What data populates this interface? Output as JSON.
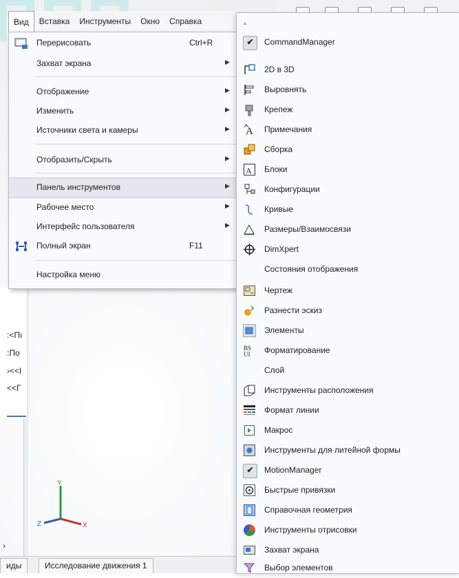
{
  "menubar": {
    "items": [
      "Вид",
      "Вставка",
      "Инструменты",
      "Окно",
      "Справка"
    ]
  },
  "view_menu": {
    "items": [
      {
        "label": "Перерисовать",
        "shortcut": "Ctrl+R",
        "icon": "redraw-icon",
        "submenu": false
      },
      {
        "label": "Захват экрана",
        "shortcut": "",
        "icon": "",
        "submenu": true
      },
      {
        "label": "Отображение",
        "shortcut": "",
        "icon": "",
        "submenu": true
      },
      {
        "label": "Изменить",
        "shortcut": "",
        "icon": "",
        "submenu": true
      },
      {
        "label": "Источники света и камеры",
        "shortcut": "",
        "icon": "",
        "submenu": true
      },
      {
        "label": "Отобразить/Скрыть",
        "shortcut": "",
        "icon": "",
        "submenu": true
      },
      {
        "label": "Панель инструментов",
        "shortcut": "",
        "icon": "",
        "submenu": true,
        "highlighted": true
      },
      {
        "label": "Рабочее место",
        "shortcut": "",
        "icon": "",
        "submenu": true
      },
      {
        "label": "Интерфейс пользователя",
        "shortcut": "",
        "icon": "",
        "submenu": true
      },
      {
        "label": "Полный экран",
        "shortcut": "F11",
        "icon": "fullscreen-icon",
        "submenu": false
      },
      {
        "label": "Настройка меню",
        "shortcut": "",
        "icon": "",
        "submenu": false
      }
    ]
  },
  "toolbars_submenu": {
    "items": [
      {
        "label": "CommandManager",
        "icon": "checkmark-icon",
        "checked": true
      },
      {
        "label": "2D в 3D",
        "icon": "2d-to-3d-icon"
      },
      {
        "label": "Выровнять",
        "icon": "align-icon"
      },
      {
        "label": "Крепеж",
        "icon": "fastener-icon"
      },
      {
        "label": "Примечания",
        "icon": "annotation-icon"
      },
      {
        "label": "Сборка",
        "icon": "assembly-icon"
      },
      {
        "label": "Блоки",
        "icon": "blocks-icon"
      },
      {
        "label": "Конфигурации",
        "icon": "configurations-icon"
      },
      {
        "label": "Кривые",
        "icon": "curves-icon"
      },
      {
        "label": "Размеры/Взаимосвязи",
        "icon": "dimensions-relations-icon"
      },
      {
        "label": "DimXpert",
        "icon": "dimxpert-icon"
      },
      {
        "label": "Состояния отображения",
        "icon": ""
      },
      {
        "label": "Чертеж",
        "icon": "drawing-icon"
      },
      {
        "label": "Разнести эскиз",
        "icon": "explode-sketch-icon"
      },
      {
        "label": "Элементы",
        "icon": "features-icon",
        "checked": true
      },
      {
        "label": "Форматирование",
        "icon": "formatting-icon"
      },
      {
        "label": "Слой",
        "icon": ""
      },
      {
        "label": "Инструменты расположения",
        "icon": "layout-tools-icon"
      },
      {
        "label": "Формат линии",
        "icon": "line-format-icon"
      },
      {
        "label": "Макрос",
        "icon": "macro-icon"
      },
      {
        "label": "Инструменты для литейной формы",
        "icon": "mold-tools-icon"
      },
      {
        "label": "MotionManager",
        "icon": "checkmark-icon",
        "checked": true
      },
      {
        "label": "Быстрые привязки",
        "icon": "quick-snaps-icon"
      },
      {
        "label": "Справочная геометрия",
        "icon": "reference-geometry-icon"
      },
      {
        "label": "Инструменты отрисовки",
        "icon": "render-tools-icon"
      },
      {
        "label": "Захват экрана",
        "icon": "screen-capture-icon"
      },
      {
        "label": "Выбор элементов",
        "icon": "selection-filter-icon"
      }
    ]
  },
  "left_panel": {
    "tree_items": [
      ":<Пı",
      ":По",
      "›<<I",
      "<<Г"
    ]
  },
  "bottom_tabs": [
    "иды",
    "Исследование движения 1"
  ],
  "axes": {
    "x": "X",
    "y": "Y",
    "z": "Z"
  },
  "colors": {
    "menu_bg": "#f9fafb",
    "highlight": "#e4e8ee",
    "accent_blue": "#3b78c8"
  }
}
